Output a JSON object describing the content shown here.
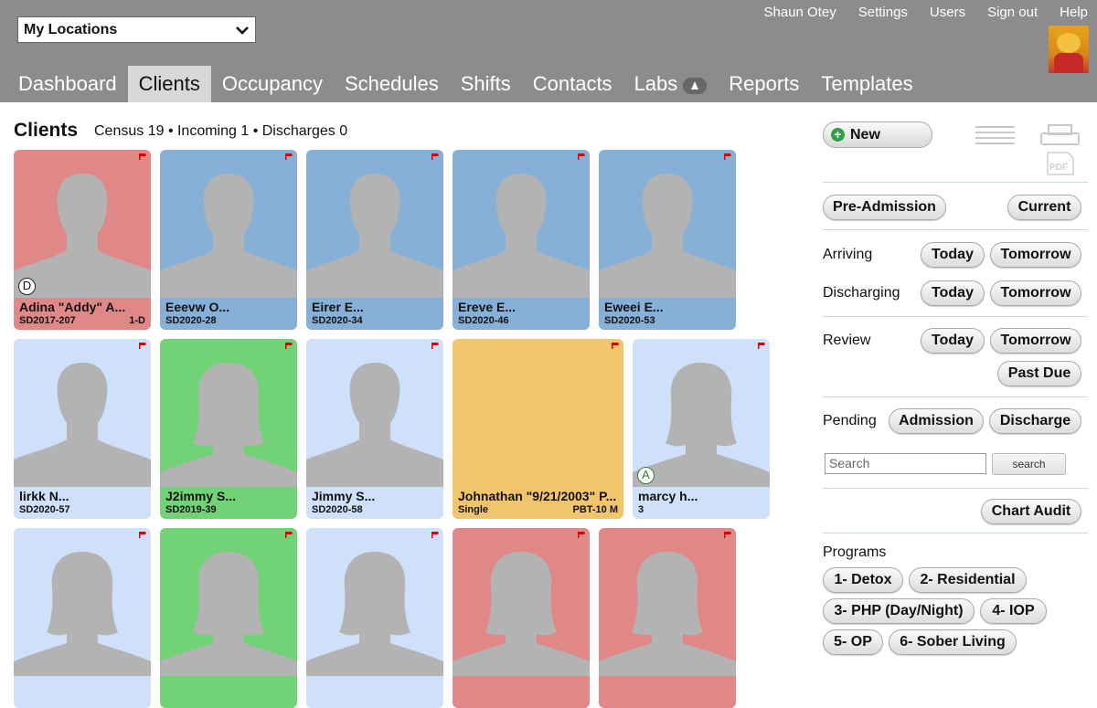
{
  "header": {
    "location_select": "My Locations",
    "user_links": [
      "Shaun Otey",
      "Settings",
      "Users",
      "Sign out",
      "Help"
    ],
    "nav": [
      "Dashboard",
      "Clients",
      "Occupancy",
      "Schedules",
      "Shifts",
      "Contacts",
      "Labs",
      "Reports",
      "Templates"
    ],
    "active_nav": "Clients"
  },
  "page": {
    "title": "Clients",
    "census_text": "Census 19 • Incoming 1 • Discharges 0"
  },
  "clients": [
    {
      "name": "Adina \"Addy\" A...",
      "id": "SD2017-207",
      "extra": "1-D",
      "color": "pink",
      "badge": "D"
    },
    {
      "name": "Eeevw O...",
      "id": "SD2020-28",
      "extra": "",
      "color": "blue",
      "badge": ""
    },
    {
      "name": "Eirer E...",
      "id": "SD2020-34",
      "extra": "",
      "color": "blue",
      "badge": ""
    },
    {
      "name": "Ereve E...",
      "id": "SD2020-46",
      "extra": "",
      "color": "blue",
      "badge": ""
    },
    {
      "name": "Eweei E...",
      "id": "SD2020-53",
      "extra": "",
      "color": "blue",
      "badge": ""
    },
    {
      "name": "lirkk N...",
      "id": "SD2020-57",
      "extra": "",
      "color": "light",
      "badge": ""
    },
    {
      "name": "J2immy S...",
      "id": "SD2019-39",
      "extra": "",
      "color": "green",
      "badge": ""
    },
    {
      "name": "Jimmy S...",
      "id": "SD2020-58",
      "extra": "",
      "color": "light",
      "badge": ""
    },
    {
      "name": "Johnathan \"9/21/2003\" P...",
      "id": "Single",
      "extra": "PBT-10 M",
      "color": "yellow",
      "badge": ""
    },
    {
      "name": "marcy h...",
      "id": "3",
      "extra": "",
      "color": "light",
      "badge": "A"
    },
    {
      "name": "",
      "id": "",
      "extra": "",
      "color": "light",
      "badge": ""
    },
    {
      "name": "",
      "id": "",
      "extra": "",
      "color": "green",
      "badge": ""
    },
    {
      "name": "",
      "id": "",
      "extra": "",
      "color": "light",
      "badge": ""
    },
    {
      "name": "",
      "id": "",
      "extra": "",
      "color": "pink",
      "badge": ""
    },
    {
      "name": "",
      "id": "",
      "extra": "",
      "color": "pink",
      "badge": ""
    }
  ],
  "panel": {
    "new_label": "New",
    "pre_admission": "Pre-Admission",
    "current": "Current",
    "arriving_label": "Arriving",
    "discharging_label": "Discharging",
    "review_label": "Review",
    "pending_label": "Pending",
    "today": "Today",
    "tomorrow": "Tomorrow",
    "past_due": "Past Due",
    "admission": "Admission",
    "discharge": "Discharge",
    "search_placeholder": "Search",
    "search_button": "search",
    "chart_audit": "Chart Audit",
    "programs_label": "Programs",
    "pdf_label": "PDF",
    "programs": [
      "1- Detox",
      "2- Residential",
      "3- PHP (Day/Night)",
      "4- IOP",
      "5- OP",
      "6- Sober Living"
    ]
  }
}
